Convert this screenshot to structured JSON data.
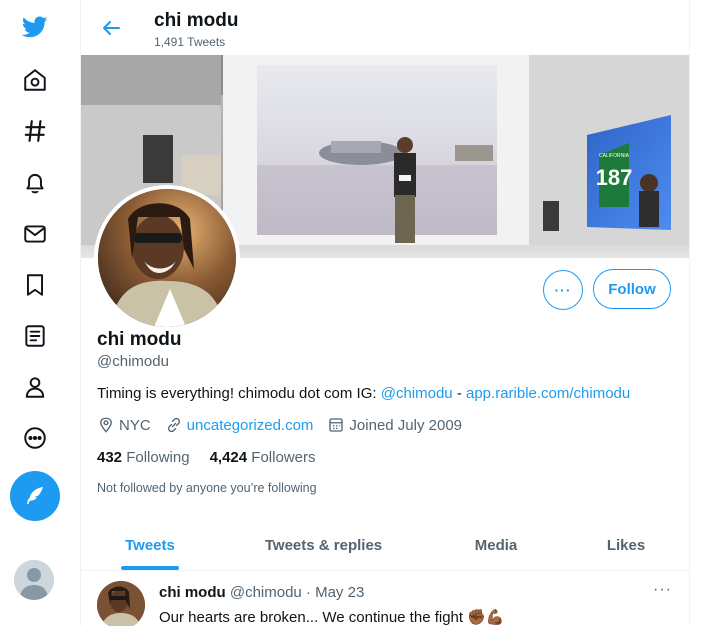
{
  "profile": {
    "title": "chi modu",
    "tweet_count": "1,491 Tweets",
    "display_name": "chi modu",
    "handle": "@chimodu",
    "bio_text": "Timing is everything! chimodu dot com IG: ",
    "bio_ig": "@chimodu",
    "bio_sep": " - ",
    "bio_link": "app.rarible.com/chimodu",
    "location": "NYC",
    "website": "uncategorized.com",
    "joined": "Joined July 2009",
    "following_count": "432",
    "following_label": " Following",
    "followers_count": "4,424",
    "followers_label": " Followers",
    "not_followed": "Not followed by anyone you’re following",
    "more_label": "···",
    "follow_label": "Follow",
    "banner_sign": "187",
    "banner_sign_caption": "CALIFORNIA"
  },
  "tabs": [
    "Tweets",
    "Tweets & replies",
    "Media",
    "Likes"
  ],
  "active_tab": "Tweets",
  "tweet": {
    "name": "chi modu",
    "meta": " @chimodu · May 23",
    "text": "Our hearts are broken... We continue the fight ✊🏾💪🏾",
    "more": "···"
  },
  "icons": {
    "sidebar": [
      "twitter-logo-icon",
      "home-icon",
      "hashtag-icon",
      "bell-icon",
      "mail-icon",
      "bookmark-icon",
      "list-icon",
      "profile-icon",
      "more-circle-icon"
    ],
    "compose": "compose-feather-icon"
  },
  "colors": {
    "accent": "#1d9bf0",
    "text": "#0f1419",
    "muted": "#536471"
  }
}
